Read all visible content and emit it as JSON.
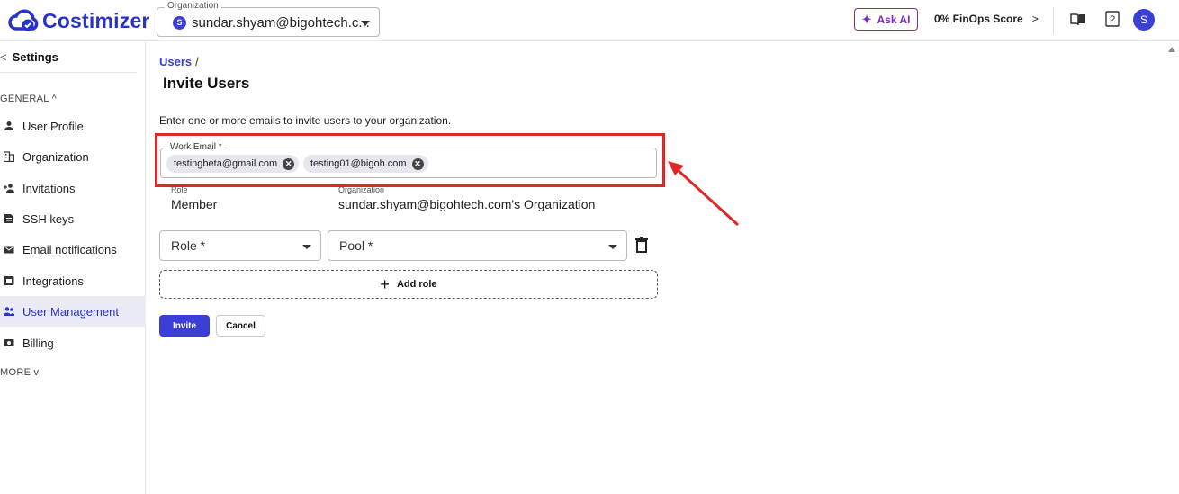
{
  "header": {
    "logo_text": "Costimizer",
    "org_label": "Organization",
    "org_avatar": "S",
    "org_value": "sundar.shyam@bigohtech.c...",
    "ask_ai_label": "Ask AI",
    "finops_label": "0% FinOps Score",
    "finops_chevron": ">",
    "user_avatar": "S"
  },
  "sidebar": {
    "back_label": "Settings",
    "back_chevron": "<",
    "section_general": "GENERAL ^",
    "section_more": "MORE v",
    "items": [
      {
        "label": "User Profile",
        "icon": "person-icon"
      },
      {
        "label": "Organization",
        "icon": "building-icon"
      },
      {
        "label": "Invitations",
        "icon": "invite-icon"
      },
      {
        "label": "SSH keys",
        "icon": "key-icon"
      },
      {
        "label": "Email notifications",
        "icon": "mail-icon"
      },
      {
        "label": "Integrations",
        "icon": "integration-icon"
      },
      {
        "label": "User Management",
        "icon": "users-icon"
      },
      {
        "label": "Billing",
        "icon": "billing-icon"
      }
    ],
    "active_index": 6
  },
  "main": {
    "breadcrumb_link": "Users",
    "breadcrumb_sep": "/",
    "title": "Invite Users",
    "intro": "Enter one or more emails to invite users to your organization.",
    "email_field_label": "Work Email *",
    "emails": [
      "testingbeta@gmail.com",
      "testing01@bigoh.com"
    ],
    "role_label": "Role",
    "role_value": "Member",
    "org_label": "Organization",
    "org_value": "sundar.shyam@bigohtech.com's Organization",
    "role_select": "Role *",
    "pool_select": "Pool *",
    "add_role": "Add role",
    "invite_button": "Invite",
    "cancel_button": "Cancel"
  },
  "colors": {
    "brand": "#2a33c7",
    "accent": "#3a3fd6",
    "ask_ai": "#7b2cbf",
    "highlight": "#e12626"
  }
}
